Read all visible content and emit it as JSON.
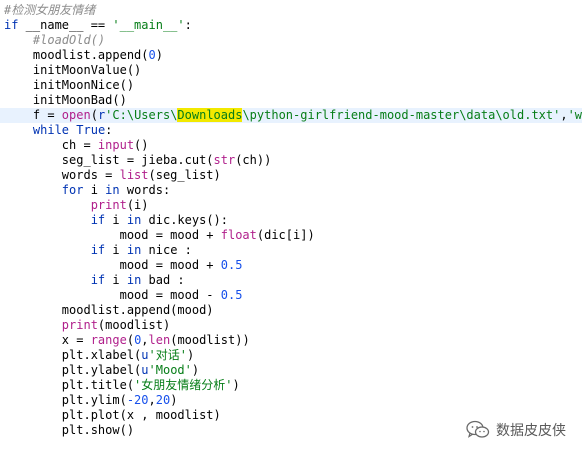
{
  "editor": {
    "language": "python",
    "highlight_color": "#e8f2fe",
    "search_match": "Downloads",
    "lines": [
      [
        {
          "t": "#检测女朋友情绪",
          "c": "comment"
        }
      ],
      [
        {
          "t": "if",
          "c": "keyword"
        },
        {
          "t": " __name__ == ",
          "c": "plain"
        },
        {
          "t": "'__main__'",
          "c": "string"
        },
        {
          "t": ":",
          "c": "plain"
        }
      ],
      [
        {
          "t": "    ",
          "c": "plain"
        },
        {
          "t": "#loadOld()",
          "c": "comment"
        }
      ],
      [
        {
          "t": "    moodlist.append(",
          "c": "plain"
        },
        {
          "t": "0",
          "c": "number"
        },
        {
          "t": ")",
          "c": "plain"
        }
      ],
      [
        {
          "t": "    initMoonValue()",
          "c": "plain"
        }
      ],
      [
        {
          "t": "    initMoonNice()",
          "c": "plain"
        }
      ],
      [
        {
          "t": "    initMoonBad()",
          "c": "plain"
        }
      ],
      [
        {
          "t": "    f = ",
          "c": "plain"
        },
        {
          "t": "open",
          "c": "builtin"
        },
        {
          "t": "(",
          "c": "plain"
        },
        {
          "t": "r",
          "c": "prefix"
        },
        {
          "t": "'C:\\Users\\",
          "c": "string"
        },
        {
          "t": "Downloads",
          "c": "match"
        },
        {
          "t": "\\python-girlfriend-mood-master\\data\\old.txt'",
          "c": "string"
        },
        {
          "t": ",",
          "c": "plain"
        },
        {
          "t": "'w'",
          "c": "string"
        },
        {
          "t": ")",
          "c": "plain"
        }
      ],
      [
        {
          "t": "    ",
          "c": "plain"
        },
        {
          "t": "while",
          "c": "keyword"
        },
        {
          "t": " ",
          "c": "plain"
        },
        {
          "t": "True",
          "c": "keyword"
        },
        {
          "t": ":",
          "c": "plain"
        }
      ],
      [
        {
          "t": "        ch = ",
          "c": "plain"
        },
        {
          "t": "input",
          "c": "builtin"
        },
        {
          "t": "()",
          "c": "plain"
        }
      ],
      [
        {
          "t": "        seg_list = jieba.cut(",
          "c": "plain"
        },
        {
          "t": "str",
          "c": "builtin"
        },
        {
          "t": "(ch))",
          "c": "plain"
        }
      ],
      [
        {
          "t": "        words = ",
          "c": "plain"
        },
        {
          "t": "list",
          "c": "builtin"
        },
        {
          "t": "(seg_list)",
          "c": "plain"
        }
      ],
      [
        {
          "t": "        ",
          "c": "plain"
        },
        {
          "t": "for",
          "c": "keyword"
        },
        {
          "t": " i ",
          "c": "plain"
        },
        {
          "t": "in",
          "c": "keyword"
        },
        {
          "t": " words:",
          "c": "plain"
        }
      ],
      [
        {
          "t": "            ",
          "c": "plain"
        },
        {
          "t": "print",
          "c": "builtin"
        },
        {
          "t": "(i)",
          "c": "plain"
        }
      ],
      [
        {
          "t": "            ",
          "c": "plain"
        },
        {
          "t": "if",
          "c": "keyword"
        },
        {
          "t": " i ",
          "c": "plain"
        },
        {
          "t": "in",
          "c": "keyword"
        },
        {
          "t": " dic.keys():",
          "c": "plain"
        }
      ],
      [
        {
          "t": "                mood = mood + ",
          "c": "plain"
        },
        {
          "t": "float",
          "c": "builtin"
        },
        {
          "t": "(dic[i])",
          "c": "plain"
        }
      ],
      [
        {
          "t": "            ",
          "c": "plain"
        },
        {
          "t": "if",
          "c": "keyword"
        },
        {
          "t": " i ",
          "c": "plain"
        },
        {
          "t": "in",
          "c": "keyword"
        },
        {
          "t": " nice :",
          "c": "plain"
        }
      ],
      [
        {
          "t": "                mood = mood + ",
          "c": "plain"
        },
        {
          "t": "0.5",
          "c": "number"
        }
      ],
      [
        {
          "t": "            ",
          "c": "plain"
        },
        {
          "t": "if",
          "c": "keyword"
        },
        {
          "t": " i ",
          "c": "plain"
        },
        {
          "t": "in",
          "c": "keyword"
        },
        {
          "t": " bad :",
          "c": "plain"
        }
      ],
      [
        {
          "t": "                mood = mood - ",
          "c": "plain"
        },
        {
          "t": "0.5",
          "c": "number"
        }
      ],
      [
        {
          "t": "        moodlist.append(mood)",
          "c": "plain"
        }
      ],
      [
        {
          "t": "        ",
          "c": "plain"
        },
        {
          "t": "print",
          "c": "builtin"
        },
        {
          "t": "(moodlist)",
          "c": "plain"
        }
      ],
      [
        {
          "t": "        x = ",
          "c": "plain"
        },
        {
          "t": "range",
          "c": "builtin"
        },
        {
          "t": "(",
          "c": "plain"
        },
        {
          "t": "0",
          "c": "number"
        },
        {
          "t": ",",
          "c": "plain"
        },
        {
          "t": "len",
          "c": "builtin"
        },
        {
          "t": "(moodlist))",
          "c": "plain"
        }
      ],
      [
        {
          "t": "        plt.xlabel(",
          "c": "plain"
        },
        {
          "t": "u",
          "c": "prefix"
        },
        {
          "t": "'对话'",
          "c": "string"
        },
        {
          "t": ")",
          "c": "plain"
        }
      ],
      [
        {
          "t": "        plt.ylabel(",
          "c": "plain"
        },
        {
          "t": "u",
          "c": "prefix"
        },
        {
          "t": "'Mood'",
          "c": "string"
        },
        {
          "t": ")",
          "c": "plain"
        }
      ],
      [
        {
          "t": "        plt.title(",
          "c": "plain"
        },
        {
          "t": "'女朋友情绪分析'",
          "c": "string"
        },
        {
          "t": ")",
          "c": "plain"
        }
      ],
      [
        {
          "t": "        plt.ylim(",
          "c": "plain"
        },
        {
          "t": "-20",
          "c": "number"
        },
        {
          "t": ",",
          "c": "plain"
        },
        {
          "t": "20",
          "c": "number"
        },
        {
          "t": ")",
          "c": "plain"
        }
      ],
      [
        {
          "t": "        plt.plot(x , moodlist)",
          "c": "plain"
        }
      ],
      [
        {
          "t": "        plt.show()",
          "c": "plain"
        }
      ]
    ]
  },
  "watermark": {
    "text": "数据皮皮侠",
    "icon": "wechat-icon"
  }
}
